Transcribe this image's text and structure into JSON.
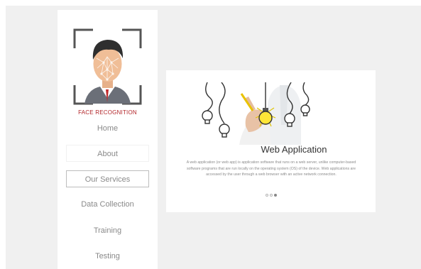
{
  "sidebar": {
    "logo_caption": "FACE RECOGNITION",
    "logo_icon": "face-recognition-logo",
    "nav": [
      {
        "label": "Home",
        "state": "normal"
      },
      {
        "label": "About",
        "state": "faint-border"
      },
      {
        "label": "Our Services",
        "state": "active"
      },
      {
        "label": "Data Collection",
        "state": "normal"
      },
      {
        "label": "Training",
        "state": "normal"
      },
      {
        "label": "Testing",
        "state": "normal"
      }
    ]
  },
  "slider": {
    "image_icon": "hand-drawing-light-bulbs-image",
    "title": "Web Application",
    "description": "A web application (or web app) is application software that runs on a web server, unlike computer-based software programs that are run locally on the operating system (OS) of the device. Web applications are accessed by the user through a web browser with an active network connection.",
    "slide_count": 3,
    "active_slide": 3
  },
  "colors": {
    "background": "#f0f0f0",
    "panel": "#ffffff",
    "caption_red": "#b3262a",
    "nav_text": "#8a8a8a"
  }
}
